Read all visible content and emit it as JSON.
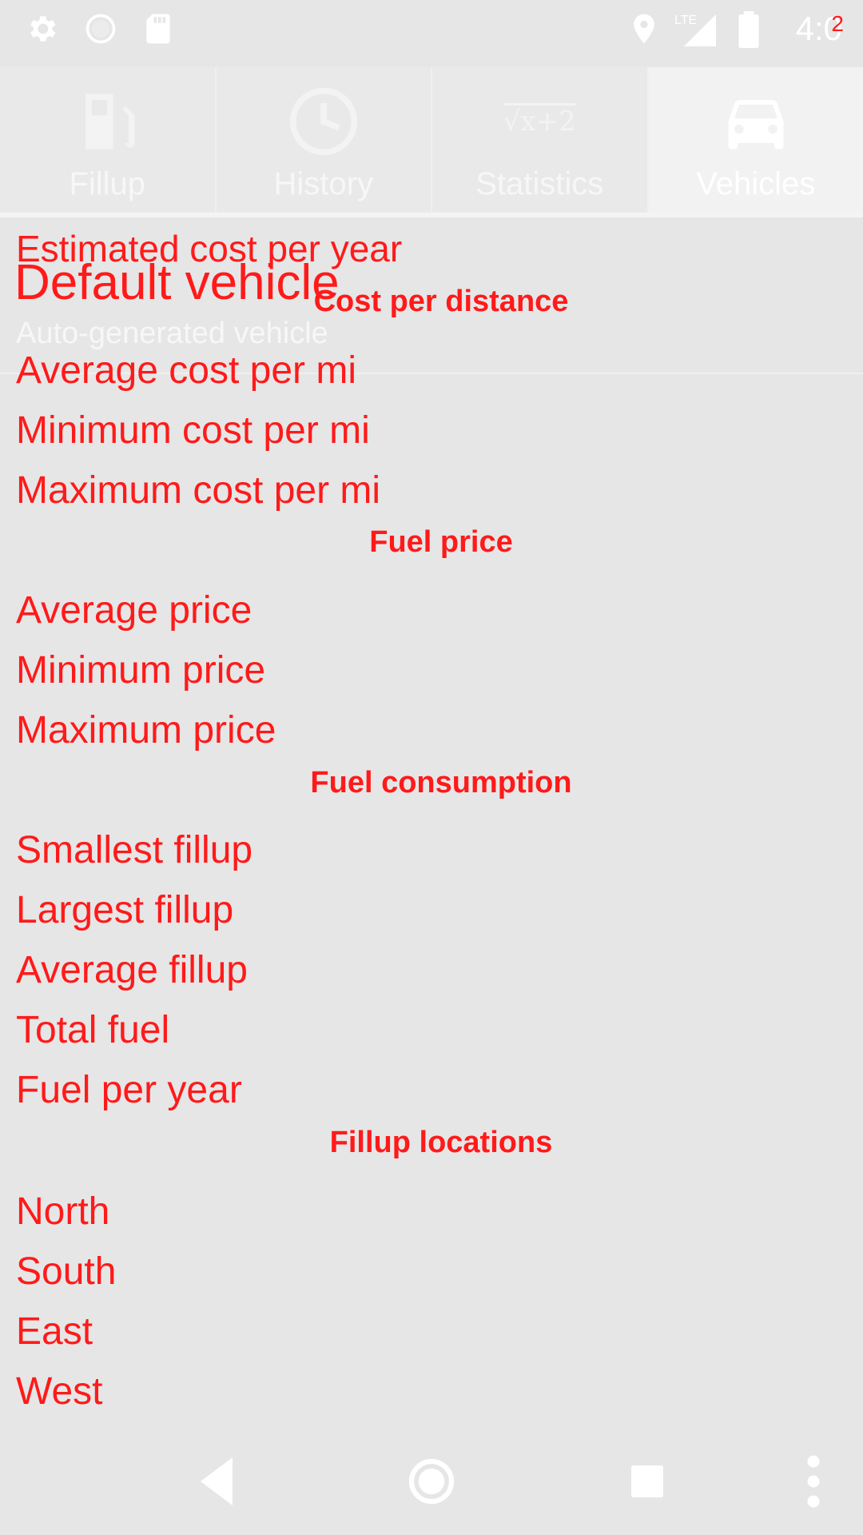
{
  "status_bar": {
    "time": "4:0",
    "time_tail": "2",
    "icons": [
      "gear-icon",
      "circle-icon",
      "sd-card-icon",
      "location-icon",
      "lte-signal-icon",
      "battery-icon"
    ]
  },
  "tabs": [
    {
      "label": "Fillup",
      "icon": "fuel-pump-icon",
      "active": false
    },
    {
      "label": "History",
      "icon": "clock-icon",
      "active": false
    },
    {
      "label": "Statistics",
      "icon": "sqrt-formula-icon",
      "active": false
    },
    {
      "label": "Vehicles",
      "icon": "car-icon",
      "active": true
    }
  ],
  "formula_text": "√x+2",
  "content": {
    "ghost_line": "Estimated cost per year",
    "vehicle_title": "Default vehicle",
    "vehicle_subtitle": "Auto-generated vehicle",
    "sections": [
      {
        "title": "Cost per distance",
        "rows": [
          "Average cost per mi",
          "Minimum cost per mi",
          "Maximum cost per mi"
        ]
      },
      {
        "title": "Fuel price",
        "rows": [
          "Average price",
          "Minimum price",
          "Maximum price"
        ]
      },
      {
        "title": "Fuel consumption",
        "rows": [
          "Smallest fillup",
          "Largest fillup",
          "Average fillup",
          "Total fuel",
          "Fuel per year"
        ]
      },
      {
        "title": "Fillup locations",
        "rows": [
          "North",
          "South",
          "East",
          "West"
        ]
      }
    ]
  },
  "colors": {
    "background": "#e6e6e6",
    "accent_text": "#ff1a1a",
    "faded_text": "#f7f7f7"
  },
  "nav_bar": {
    "items": [
      "back-icon",
      "home-icon",
      "recents-icon",
      "overflow-menu-icon"
    ]
  }
}
